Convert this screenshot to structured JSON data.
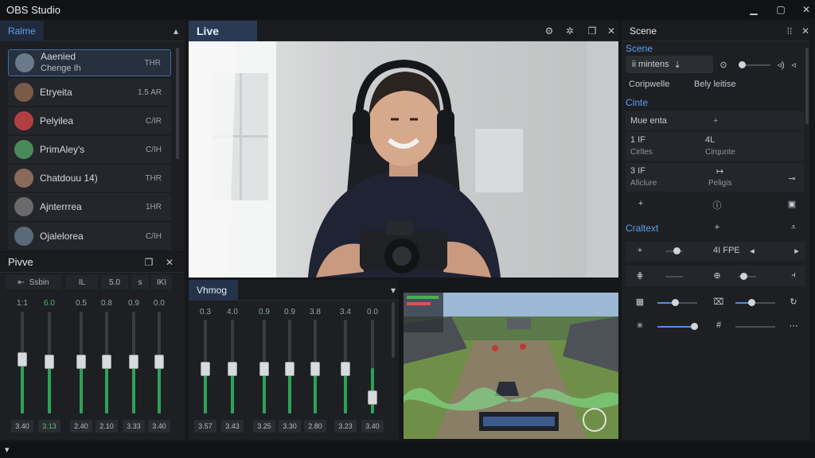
{
  "app": {
    "title": "OBS Studio"
  },
  "left_panel": {
    "tab": "Ralme",
    "items": [
      {
        "name": "Aaenied",
        "sub": "Chenge Ih",
        "value": "THR",
        "avatar_color": "#6a7a8c"
      },
      {
        "name": "Etryeita",
        "value": "1.5 AR",
        "avatar_color": "#7b5a4a"
      },
      {
        "name": "Pelyilea",
        "value": "C/IR",
        "avatar_color": "#b04040"
      },
      {
        "name": "PrimAley's",
        "value": "C/IH",
        "avatar_color": "#4a8a5a"
      },
      {
        "name": "Chatdouu 14)",
        "value": "THR",
        "avatar_color": "#8a6a5a"
      },
      {
        "name": "Ajnterrrea",
        "value": "1HR",
        "avatar_color": "#6a6a6a"
      },
      {
        "name": "Ojalelorea",
        "value": "C/IH",
        "avatar_color": "#5a6a7a"
      }
    ]
  },
  "mixer_left": {
    "tab": "Pivve",
    "controls": [
      "Ssbin",
      "IL",
      "5.0",
      "s",
      "IKI"
    ],
    "channels": [
      {
        "label": "1:1",
        "value": "3.40",
        "level": 0.55,
        "fader": 0.6,
        "green": false
      },
      {
        "label": "6.0",
        "value": "3.13",
        "level": 0.45,
        "fader": 0.58,
        "green": true
      },
      {
        "label": "0.5",
        "value": "2.40",
        "level": 0.5,
        "fader": 0.58,
        "green": false
      },
      {
        "label": "0.8",
        "value": "2.10",
        "level": 0.48,
        "fader": 0.58,
        "green": false
      },
      {
        "label": "0.9",
        "value": "3.33",
        "level": 0.5,
        "fader": 0.58,
        "green": false
      },
      {
        "label": "0.0",
        "value": "3.40",
        "level": 0.52,
        "fader": 0.58,
        "green": false
      }
    ]
  },
  "live": {
    "tab": "Live"
  },
  "mixer_center": {
    "tab": "Vhmog",
    "channels": [
      {
        "label": "0.3",
        "value": "3.57",
        "level": 0.48,
        "fader": 0.55
      },
      {
        "label": "4.0",
        "value": "3.43",
        "level": 0.48,
        "fader": 0.55
      },
      {
        "label": "0.9",
        "value": "3.25",
        "level": 0.48,
        "fader": 0.55
      },
      {
        "label": "0.9",
        "value": "3.30",
        "level": 0.48,
        "fader": 0.55
      },
      {
        "label": "3.8",
        "value": "2.80",
        "level": 0.48,
        "fader": 0.55
      },
      {
        "label": "3.4",
        "value": "3.23",
        "level": 0.48,
        "fader": 0.55
      },
      {
        "label": "0.0",
        "value": "3.40",
        "level": 0.48,
        "fader": 0.25
      }
    ]
  },
  "right_panel": {
    "tab": "Scene",
    "scene_section": "Scene",
    "scene_input": "ii mintens",
    "row1": [
      "Coripwelle",
      "Bely leitise"
    ],
    "sources_section": "Cinte",
    "source_row": "Mue enta",
    "grid": [
      {
        "top": "1 IF",
        "bottom": "Cirlles"
      },
      {
        "top": "4L",
        "bottom": "Cirqunte"
      },
      {
        "top": "3 IF",
        "bottom": "Aficlure"
      },
      {
        "top": "↦",
        "bottom": "Peligis"
      }
    ],
    "controls_section": "Craltext",
    "fps_label": "4I FPE"
  },
  "colors": {
    "accent": "#5aa0f0",
    "level": "#2aa357",
    "active_tab": "#2a3a55"
  }
}
